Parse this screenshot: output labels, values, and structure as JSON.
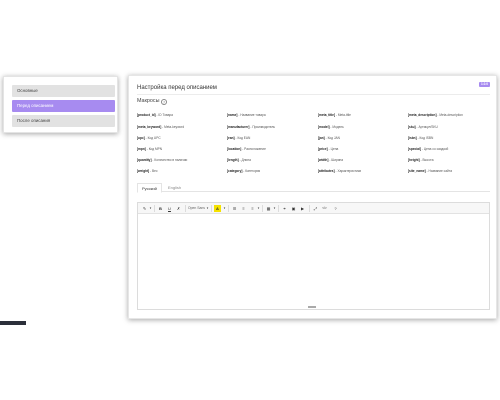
{
  "nav": {
    "items": [
      {
        "label": "Основные",
        "active": false
      },
      {
        "label": "Перед описанием",
        "active": true
      },
      {
        "label": "После описания",
        "active": false
      }
    ]
  },
  "panel": {
    "version": "1.0.0",
    "title": "Настройка перед описанием",
    "macros_heading": "Макросы",
    "info_icon": "?"
  },
  "macros": [
    [
      {
        "code": "[product_id]",
        "desc": " - ID Товара"
      },
      {
        "code": "[name]",
        "desc": " - Название товара"
      },
      {
        "code": "[meta_title]",
        "desc": " - Meta-title"
      },
      {
        "code": "[meta_description]",
        "desc": " - Meta-description"
      }
    ],
    [
      {
        "code": "[meta_keyword]",
        "desc": " - Meta-keyword"
      },
      {
        "code": "[manufacturer]",
        "desc": " - Производитель"
      },
      {
        "code": "[model]",
        "desc": " - Модель"
      },
      {
        "code": "[sku]",
        "desc": " - Артикул/SKU"
      }
    ],
    [
      {
        "code": "[upc]",
        "desc": " - Код UPC"
      },
      {
        "code": "[ean]",
        "desc": " - Код EAN"
      },
      {
        "code": "[jan]",
        "desc": " - Код JAN"
      },
      {
        "code": "[isbn]",
        "desc": " - Код ISBN"
      }
    ],
    [
      {
        "code": "[mpn]",
        "desc": " - Код MPN"
      },
      {
        "code": "[location]",
        "desc": " - Расположение"
      },
      {
        "code": "[price]",
        "desc": " - Цена"
      },
      {
        "code": "[special]",
        "desc": " - Цена со скидкой"
      }
    ],
    [
      {
        "code": "[quantity]",
        "desc": " - Количество в наличии"
      },
      {
        "code": "[length]",
        "desc": " - Длина"
      },
      {
        "code": "[width]",
        "desc": " - Ширина"
      },
      {
        "code": "[height]",
        "desc": " - Высота"
      }
    ],
    [
      {
        "code": "[weight]",
        "desc": " - Вес"
      },
      {
        "code": "[category]",
        "desc": " - Категория"
      },
      {
        "code": "[attributes]",
        "desc": " - Характеристики"
      },
      {
        "code": "[site_name]",
        "desc": " - Название сайта"
      }
    ]
  ],
  "tabs": [
    {
      "label": "Русский",
      "active": true
    },
    {
      "label": "English",
      "active": false
    }
  ],
  "editor": {
    "toolbar": {
      "style_icon": "✎",
      "dropdown_caret": "▾",
      "bold": "B",
      "underline": "U",
      "clear_format": "✗",
      "font_name": "Open Sans",
      "color_icon": "A",
      "ul_icon": "☰",
      "ol_icon": "≡",
      "align_icon": "≡",
      "table_icon": "▦",
      "link_icon": "⚭",
      "picture_icon": "▣",
      "video_icon": "▶",
      "fullscreen_icon": "⤢",
      "code_icon": "</>",
      "help_icon": "?"
    },
    "color_accent": "#f5e200"
  },
  "colors": {
    "accent": "#a78bf0",
    "nav_inactive": "#e2e2e2"
  }
}
